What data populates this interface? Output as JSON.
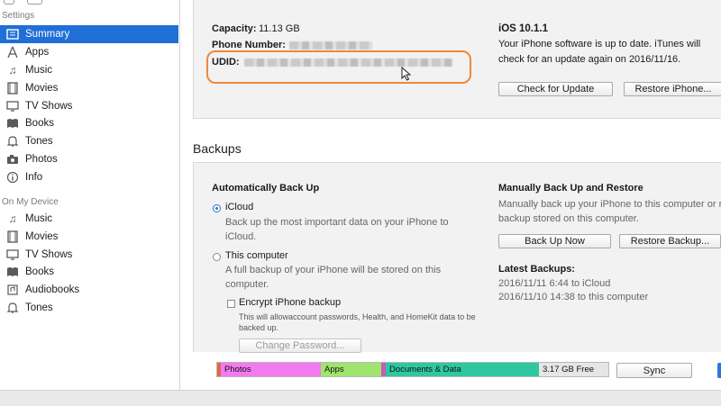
{
  "sidebar": {
    "settings_header": "Settings",
    "settings_items": [
      {
        "label": "Summary",
        "icon": "summary-icon",
        "active": true
      },
      {
        "label": "Apps",
        "icon": "apps-icon"
      },
      {
        "label": "Music",
        "icon": "music-note-icon"
      },
      {
        "label": "Movies",
        "icon": "film-icon"
      },
      {
        "label": "TV Shows",
        "icon": "tv-icon"
      },
      {
        "label": "Books",
        "icon": "book-icon"
      },
      {
        "label": "Tones",
        "icon": "bell-icon"
      },
      {
        "label": "Photos",
        "icon": "camera-icon"
      },
      {
        "label": "Info",
        "icon": "info-icon"
      }
    ],
    "device_header": "On My Device",
    "device_items": [
      {
        "label": "Music",
        "icon": "music-note-icon"
      },
      {
        "label": "Movies",
        "icon": "film-icon"
      },
      {
        "label": "TV Shows",
        "icon": "tv-icon"
      },
      {
        "label": "Books",
        "icon": "book-icon"
      },
      {
        "label": "Audiobooks",
        "icon": "audiobook-icon"
      },
      {
        "label": "Tones",
        "icon": "bell-icon"
      }
    ]
  },
  "summary": {
    "capacity_label": "Capacity:",
    "capacity_value": "11.13 GB",
    "phone_label": "Phone Number:",
    "udid_label": "UDID:",
    "ios_version": "iOS 10.1.1",
    "ios_status_line1": "Your iPhone software is up to date. iTunes will",
    "ios_status_line2": "check for an update again on 2016/11/16.",
    "check_update_button": "Check for Update",
    "restore_button": "Restore iPhone..."
  },
  "backups": {
    "heading": "Backups",
    "auto_heading": "Automatically Back Up",
    "icloud_label": "iCloud",
    "icloud_desc_line1": "Back up the most important data on your iPhone to",
    "icloud_desc_line2": "iCloud.",
    "computer_label": "This computer",
    "computer_desc_line1": "A full backup of your iPhone will be stored on this",
    "computer_desc_line2": "computer.",
    "encrypt_label": "Encrypt iPhone backup",
    "encrypt_desc_line1": "This will allowaccount passwords, Health, and HomeKit data to be",
    "encrypt_desc_line2": "backed up.",
    "change_password_button": "Change Password...",
    "manual_heading": "Manually Back Up and Restore",
    "manual_desc_line1": "Manually back up your iPhone to this computer or r",
    "manual_desc_line2": "backup stored on this computer.",
    "back_up_now_button": "Back Up Now",
    "restore_backup_button": "Restore Backup...",
    "latest_heading": "Latest Backups:",
    "latest_1": "2016/11/11 6:44 to iCloud",
    "latest_2": "2016/11/10 14:38 to this computer"
  },
  "capacity_bar": {
    "segments": [
      {
        "label": "",
        "color": "#e0683e"
      },
      {
        "label": "Photos",
        "color": "#f27af0"
      },
      {
        "label": "Apps",
        "color": "#9fe46e"
      },
      {
        "label": "",
        "color": "#c85bb8"
      },
      {
        "label": "Documents & Data",
        "color": "#2fc7a0"
      }
    ],
    "free_label": "3.17 GB Free",
    "sync_button": "Sync"
  },
  "colors": {
    "accent": "#1f6fd6",
    "highlight": "#f0873c"
  }
}
